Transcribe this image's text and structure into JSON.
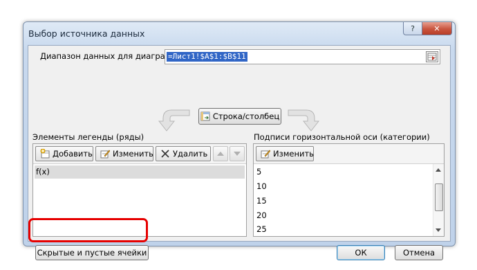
{
  "window": {
    "title": "Выбор источника данных",
    "help_label": "?",
    "close_label": "✕"
  },
  "range": {
    "label": "Диапазон данных для диаграммы:",
    "value": "=Лист1!$A$1:$B$11",
    "picker_icon": "range-picker-icon"
  },
  "swap_button": {
    "label": "Строка/столбец",
    "icon": "switch-row-column-icon"
  },
  "legend": {
    "heading": "Элементы легенды (ряды)",
    "add_label": "Добавить",
    "edit_label": "Изменить",
    "delete_label": "Удалить",
    "items": [
      "f(x)"
    ]
  },
  "axis": {
    "heading": "Подписи горизонтальной оси (категории)",
    "edit_label": "Изменить",
    "items": [
      "5",
      "10",
      "15",
      "20",
      "25"
    ]
  },
  "footer": {
    "hidden_cells_label": "Скрытые и пустые ячейки",
    "ok_label": "ОК",
    "cancel_label": "Отмена"
  },
  "colors": {
    "highlight_ring": "#e60000",
    "selection_blue": "#3166c6"
  }
}
